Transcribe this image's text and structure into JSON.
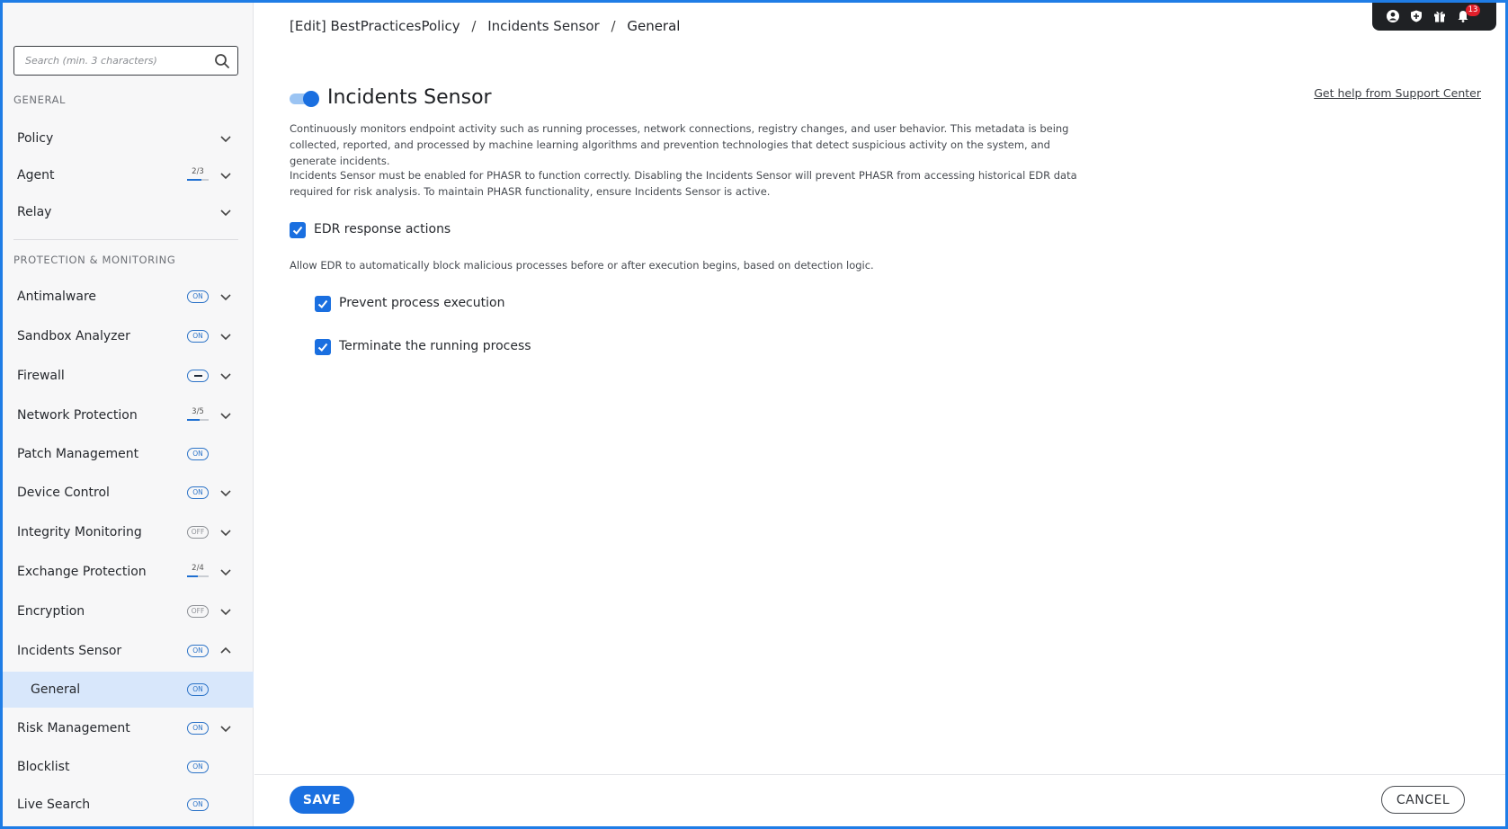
{
  "sidebar": {
    "search_placeholder": "Search (min. 3 characters)",
    "sections": {
      "general": "GENERAL",
      "protection": "PROTECTION & MONITORING"
    },
    "items": {
      "policy": {
        "label": "Policy"
      },
      "agent": {
        "label": "Agent",
        "status": "2/3",
        "done": 2,
        "total": 3
      },
      "relay": {
        "label": "Relay"
      },
      "antimalware": {
        "label": "Antimalware",
        "status": "ON"
      },
      "sandbox": {
        "label": "Sandbox Analyzer",
        "status": "ON"
      },
      "firewall": {
        "label": "Firewall",
        "status": "partial"
      },
      "network": {
        "label": "Network Protection",
        "status": "3/5",
        "done": 3,
        "total": 5
      },
      "patch": {
        "label": "Patch Management",
        "status": "ON"
      },
      "device": {
        "label": "Device Control",
        "status": "ON"
      },
      "integrity": {
        "label": "Integrity Monitoring",
        "status": "OFF"
      },
      "exchange": {
        "label": "Exchange Protection",
        "status": "2/4",
        "done": 2,
        "total": 4
      },
      "encryption": {
        "label": "Encryption",
        "status": "OFF"
      },
      "incidents": {
        "label": "Incidents Sensor",
        "status": "ON"
      },
      "general": {
        "label": "General",
        "status": "ON"
      },
      "risk": {
        "label": "Risk Management",
        "status": "ON"
      },
      "blocklist": {
        "label": "Blocklist",
        "status": "ON"
      },
      "livesearch": {
        "label": "Live Search",
        "status": "ON"
      }
    }
  },
  "breadcrumb": {
    "part1": "[Edit] BestPracticesPolicy",
    "part2": "Incidents Sensor",
    "part3": "General",
    "separator": "/"
  },
  "topbar": {
    "icons": [
      "user-icon",
      "shield-icon",
      "gift-icon",
      "bell-icon"
    ],
    "notification_count": "13"
  },
  "main": {
    "title": "Incidents Sensor",
    "enabled": true,
    "help_link": "Get help from Support Center",
    "desc1": "Continuously monitors endpoint activity such as running processes, network connections, registry changes, and user behavior. This metadata is being collected, reported, and processed by machine learning algorithms and prevention technologies that detect suspicious activity on the system, and generate incidents.",
    "desc2": "Incidents Sensor must be enabled for PHASR to function correctly. Disabling the Incidents Sensor will prevent PHASR from accessing historical EDR data required for risk analysis. To maintain PHASR functionality, ensure Incidents Sensor is active.",
    "edr_label": "EDR response actions",
    "edr_desc": "Allow EDR to automatically block malicious processes before or after execution begins, based on detection logic.",
    "prevent_label": "Prevent process execution",
    "terminate_label": "Terminate the running process"
  },
  "footer": {
    "save_label": "SAVE",
    "cancel_label": "CANCEL"
  },
  "colors": {
    "accent": "#1a6fe0",
    "selected_bg": "#d8e7fb",
    "border": "#1f7de6",
    "notification": "#e01f2b"
  }
}
